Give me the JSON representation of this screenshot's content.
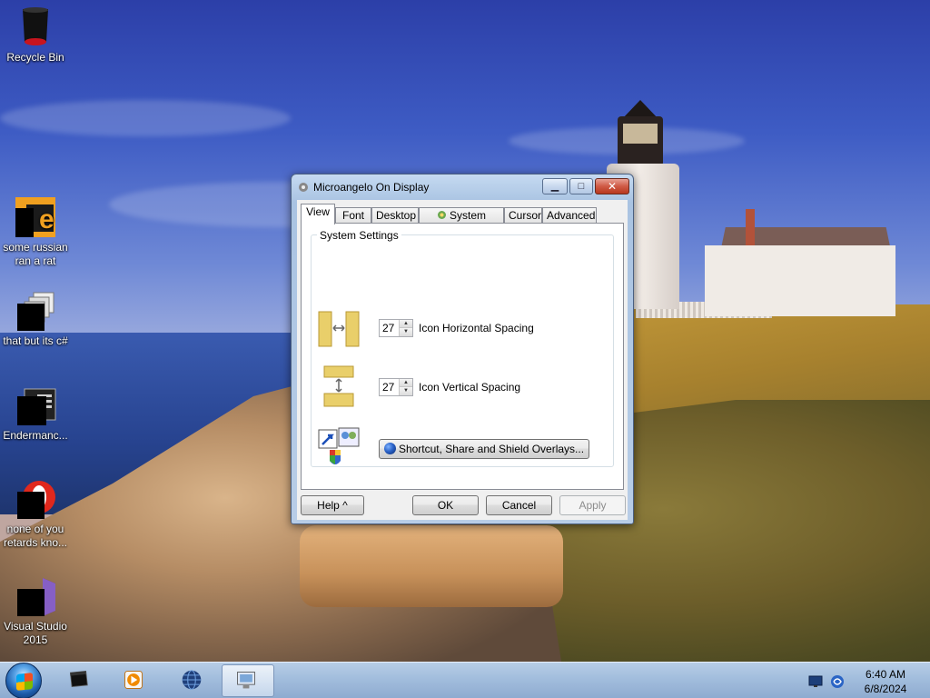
{
  "desktop": {
    "icons": [
      {
        "label": "Recycle Bin",
        "icon": "recycle-bin-icon"
      },
      {
        "label": "some russian ran a rat",
        "icon": "image-file-icon"
      },
      {
        "label": "that but its c#",
        "icon": "copy-files-icon"
      },
      {
        "label": "Endermanc...",
        "icon": "application-icon"
      },
      {
        "label": "none of you retards kno...",
        "icon": "opera-icon"
      },
      {
        "label": "Visual Studio 2015",
        "icon": "visual-studio-icon"
      }
    ]
  },
  "window": {
    "title": "Microangelo On Display",
    "controls": {
      "minimize": "▁",
      "maximize": "□",
      "close": "✕"
    },
    "tabs": [
      {
        "label": "View",
        "active": true
      },
      {
        "label": "Font"
      },
      {
        "label": "Desktop"
      },
      {
        "label": "System Icons",
        "icon": "system-icons-icon"
      },
      {
        "label": "Cursor"
      },
      {
        "label": "Advanced"
      }
    ],
    "group": {
      "label": "System Settings",
      "horizontal": {
        "value": "27",
        "label": "Icon Horizontal Spacing"
      },
      "vertical": {
        "value": "27",
        "label": "Icon Vertical Spacing"
      },
      "overlays_button": "Shortcut, Share and Shield Overlays..."
    },
    "buttons": {
      "help": "Help ^",
      "ok": "OK",
      "cancel": "Cancel",
      "apply": "Apply"
    }
  },
  "taskbar": {
    "pinned": [
      "terminal-icon",
      "media-player-icon",
      "globe-icon",
      "display-settings-icon"
    ],
    "clock": {
      "time": "6:40 AM",
      "date": "6/8/2024"
    },
    "tray_icons": [
      "monitor-icon",
      "network-icon"
    ]
  }
}
